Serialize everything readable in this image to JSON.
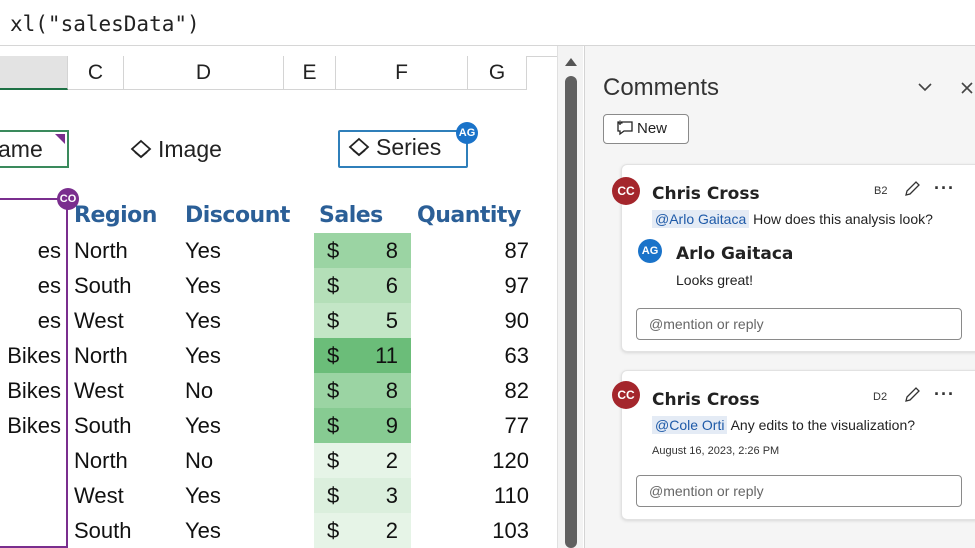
{
  "formula": {
    "text": "xl(\"salesData\")"
  },
  "columns": [
    "",
    "C",
    "D",
    "E",
    "F",
    "G"
  ],
  "shapes": {
    "name_partial": "ame",
    "image": "Image",
    "series": "Series",
    "badge_ag": "AG",
    "badge_co": "CO"
  },
  "headers": {
    "region": "Region",
    "discount": "Discount",
    "sales": "Sales",
    "quantity": "Quantity"
  },
  "rows": [
    {
      "name": "es",
      "region": "North",
      "discount": "Yes",
      "currency": "$",
      "sales": "8",
      "quantity": "87",
      "color": "#9bd4a3"
    },
    {
      "name": "es",
      "region": "South",
      "discount": "Yes",
      "currency": "$",
      "sales": "6",
      "quantity": "97",
      "color": "#b4dfb8"
    },
    {
      "name": "es",
      "region": "West",
      "discount": "Yes",
      "currency": "$",
      "sales": "5",
      "quantity": "90",
      "color": "#c3e6c6"
    },
    {
      "name": "Bikes",
      "region": "North",
      "discount": "Yes",
      "currency": "$",
      "sales": "11",
      "quantity": "63",
      "color": "#6bbd79"
    },
    {
      "name": "Bikes",
      "region": "West",
      "discount": "No",
      "currency": "$",
      "sales": "8",
      "quantity": "82",
      "color": "#9bd4a3"
    },
    {
      "name": "Bikes",
      "region": "South",
      "discount": "Yes",
      "currency": "$",
      "sales": "9",
      "quantity": "77",
      "color": "#87cb92"
    },
    {
      "name": "",
      "region": "North",
      "discount": "No",
      "currency": "$",
      "sales": "2",
      "quantity": "120",
      "color": "#e6f4e7"
    },
    {
      "name": "",
      "region": "West",
      "discount": "Yes",
      "currency": "$",
      "sales": "3",
      "quantity": "110",
      "color": "#dbefdd"
    },
    {
      "name": "",
      "region": "South",
      "discount": "Yes",
      "currency": "$",
      "sales": "2",
      "quantity": "103",
      "color": "#e6f4e7"
    }
  ],
  "comments_pane": {
    "title": "Comments",
    "new_label": "New",
    "reply_placeholder": "@mention or reply",
    "threads": [
      {
        "author_initials": "CC",
        "author": "Chris Cross",
        "cell": "B2",
        "mention": "@Arlo Gaitaca",
        "text": "How does this analysis look?",
        "reply": {
          "initials": "AG",
          "author": "Arlo Gaitaca",
          "text": "Looks great!"
        }
      },
      {
        "author_initials": "CC",
        "author": "Chris Cross",
        "cell": "D2",
        "mention": "@Cole Orti",
        "text": "Any edits to the  visualization?",
        "timestamp": "August 16, 2023, 2:26 PM"
      }
    ]
  },
  "colors": {
    "accent_blue": "#2b5f97",
    "avatar_cc": "#a4262c",
    "avatar_ag": "#1a73c9",
    "avatar_co": "#7a2e8e",
    "selection_green": "#1e7145"
  }
}
